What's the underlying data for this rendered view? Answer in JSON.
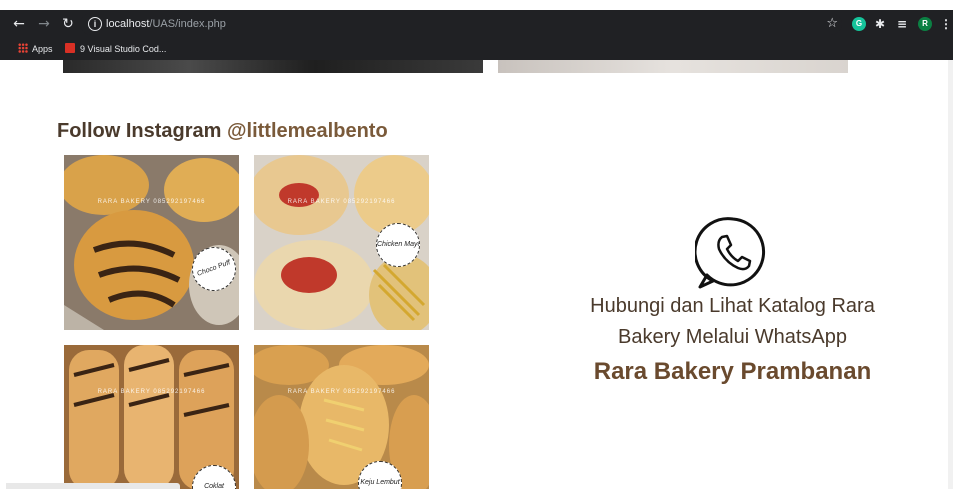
{
  "browser": {
    "url_host": "localhost",
    "url_path": "/UAS/index.php",
    "bookmarks": [
      {
        "label": "Apps"
      },
      {
        "label": "9 Visual Studio Cod..."
      }
    ],
    "profile_initial": "R",
    "extension_initial": "G"
  },
  "page": {
    "instagram_title": "Follow Instagram ",
    "instagram_handle": "@littlemealbento",
    "photos": [
      {
        "watermark": "RARA BAKERY 085292197466",
        "sticker": "Choco Puff"
      },
      {
        "watermark": "RARA BAKERY 085292197466",
        "sticker": "Chicken Mayo"
      },
      {
        "watermark": "RARA BAKERY 085292197466",
        "sticker": "Coklat"
      },
      {
        "watermark": "RARA BAKERY 085292197466",
        "sticker": "Keju Lembut"
      }
    ],
    "whatsapp_text": "Hubungi dan Lihat Katalog Rara Bakery Melalui WhatsApp",
    "bakery_name": "Rara Bakery Prambanan"
  },
  "icons": {
    "whatsapp": "whatsapp-phone-icon",
    "back": "arrow-left-icon",
    "forward": "arrow-right-icon",
    "reload": "reload-icon",
    "info": "info-icon",
    "star": "star-icon"
  },
  "colors": {
    "chrome_bg": "#202124",
    "title_text": "#4a3a2c",
    "brand_brown": "#6a4a2e"
  }
}
